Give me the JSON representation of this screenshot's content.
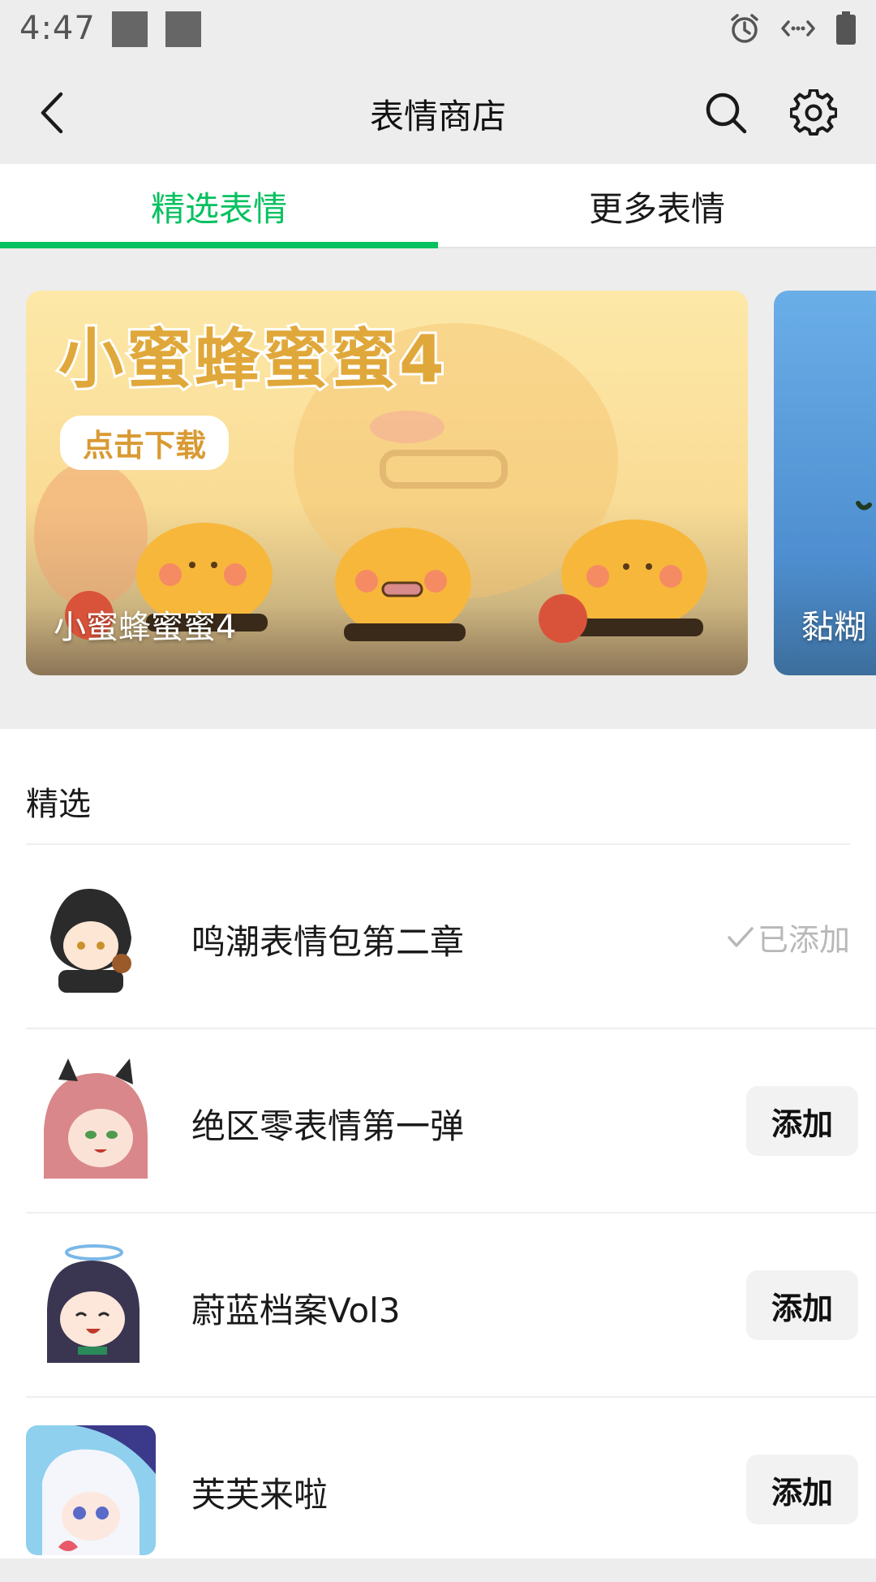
{
  "status_bar": {
    "time": "4:47",
    "icons": [
      "notification-square-icon",
      "notification-square-icon",
      "alarm-icon",
      "data-sync-icon",
      "battery-icon"
    ]
  },
  "nav": {
    "title": "表情商店",
    "icons": [
      "back-icon",
      "search-icon",
      "gear-icon"
    ]
  },
  "tabs": [
    {
      "label": "精选表情",
      "active": true
    },
    {
      "label": "更多表情",
      "active": false
    }
  ],
  "banners": [
    {
      "caption": "小蜜蜂蜜蜜4",
      "headline": "小蜜蜂蜜蜜4",
      "pill": "点击下载"
    },
    {
      "caption": "黏糊"
    }
  ],
  "section": {
    "title": "精选"
  },
  "items": [
    {
      "name": "鸣潮表情包第二章",
      "status": "added",
      "status_label": "已添加"
    },
    {
      "name": "绝区零表情第一弹",
      "status": "add",
      "button_label": "添加"
    },
    {
      "name": "蔚蓝档案Vol3",
      "status": "add",
      "button_label": "添加"
    },
    {
      "name": "芙芙来啦",
      "status": "add",
      "button_label": "添加"
    }
  ],
  "colors": {
    "accent": "#07c160",
    "background": "#ededed",
    "muted_text": "#b8b8b8"
  }
}
